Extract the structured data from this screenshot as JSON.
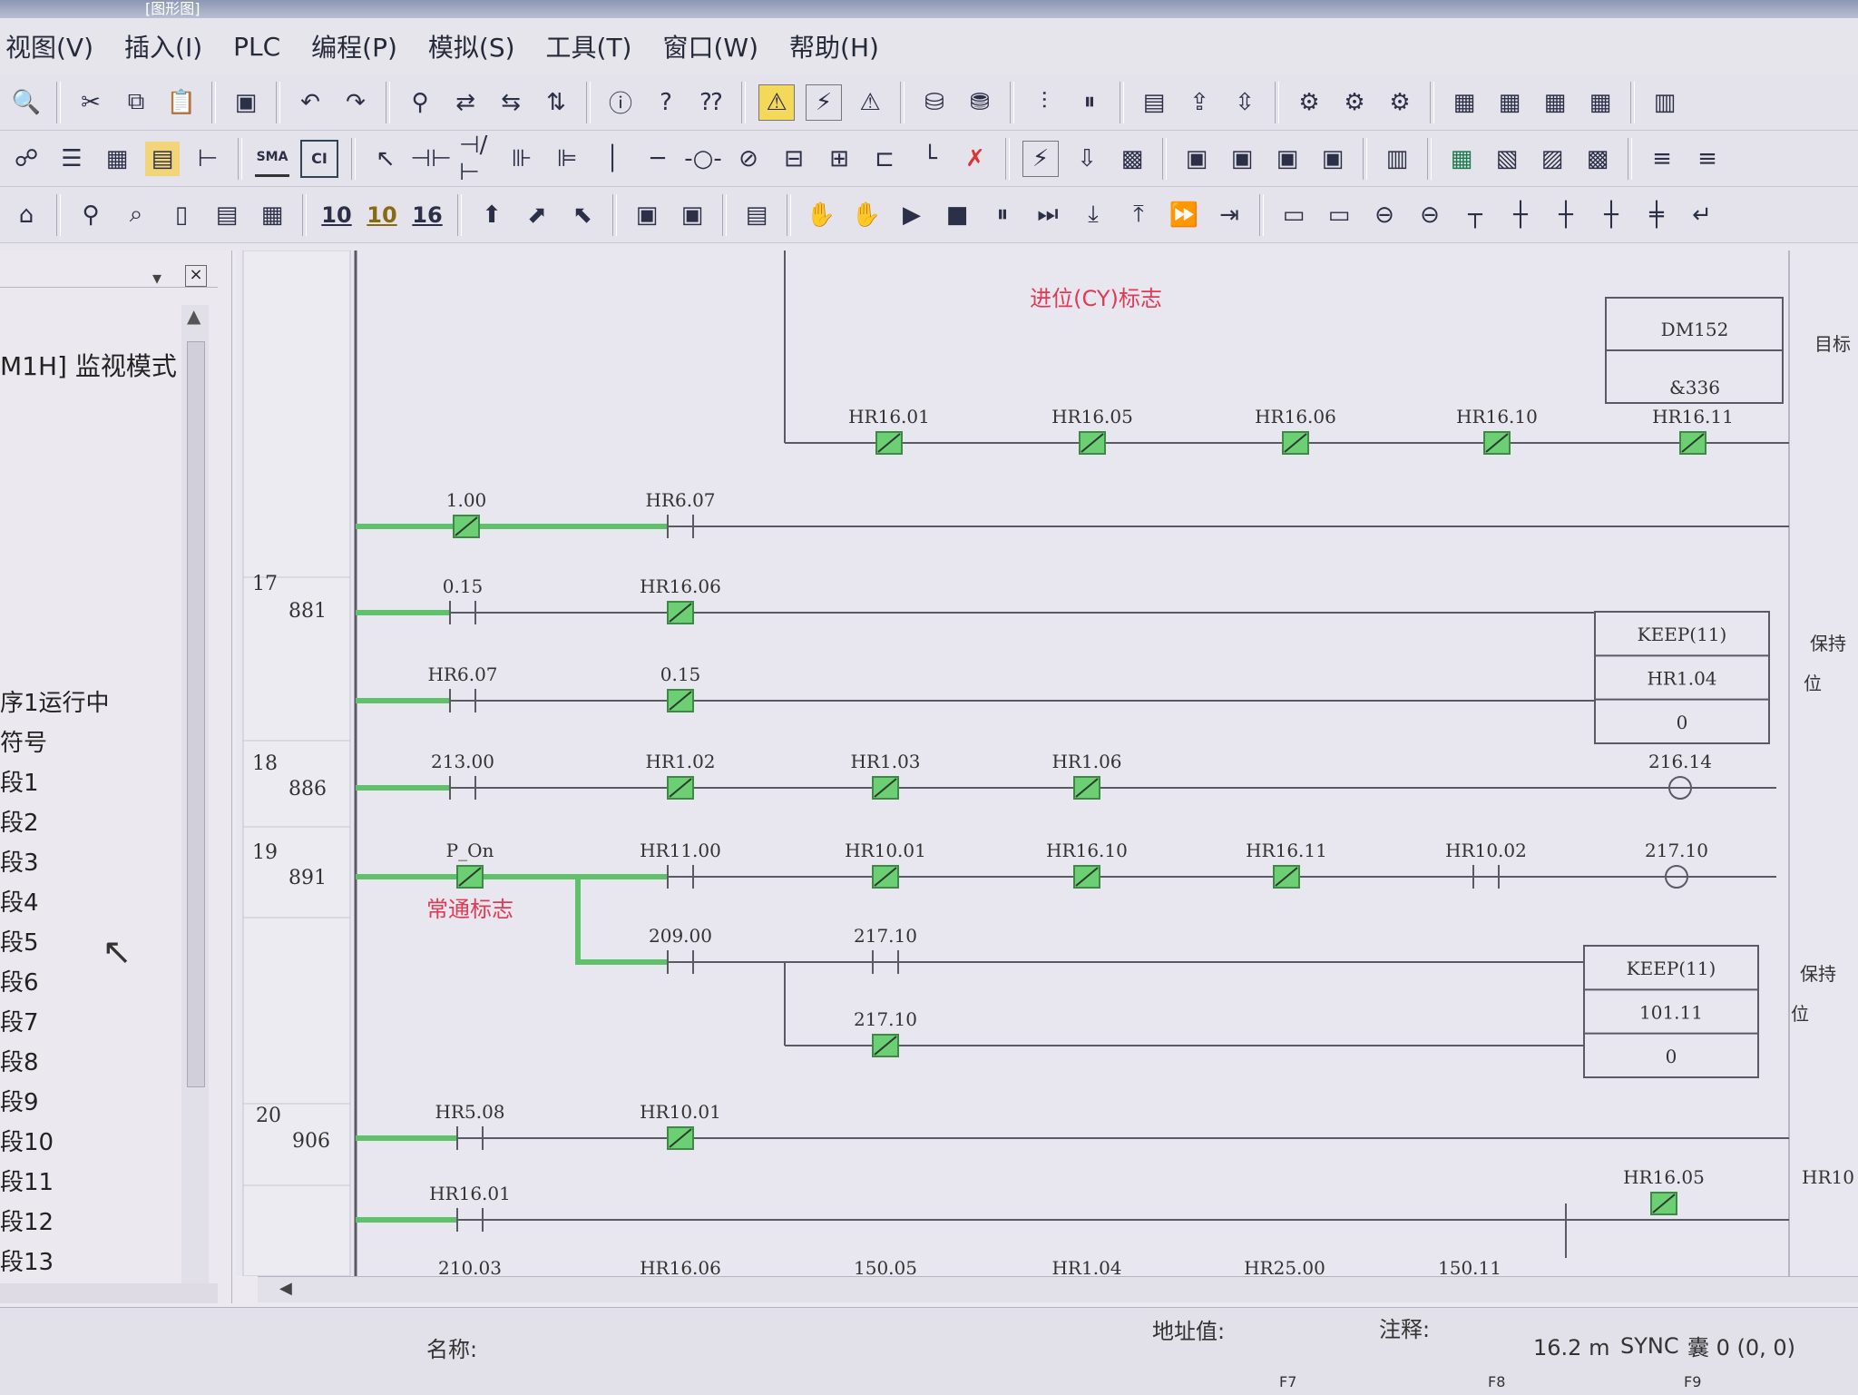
{
  "window": {
    "title": "[图形图]"
  },
  "menu": [
    {
      "id": "view",
      "label": "视图(V)"
    },
    {
      "id": "insert",
      "label": "插入(I)"
    },
    {
      "id": "plc",
      "label": "PLC"
    },
    {
      "id": "program",
      "label": "编程(P)"
    },
    {
      "id": "simulate",
      "label": "模拟(S)"
    },
    {
      "id": "tools",
      "label": "工具(T)"
    },
    {
      "id": "window",
      "label": "窗口(W)"
    },
    {
      "id": "help",
      "label": "帮助(H)"
    }
  ],
  "toolbar_labels": {
    "sma": "SMA",
    "ci": "CI",
    "n10a": "10",
    "n10b": "10",
    "n16": "16"
  },
  "project_panel": {
    "mode_text": "M1H] 监视模式",
    "items": [
      "序1运行中",
      "符号",
      "段1",
      "段2",
      "段3",
      "段4",
      "段5",
      "段6",
      "段7",
      "段8",
      "段9",
      "段10",
      "段11",
      "段12",
      "段13"
    ]
  },
  "ladder": {
    "annotations": {
      "carry_flag": "进位(CY)标志",
      "always_on": "常通标志",
      "target": "目标",
      "keep_a": "保持",
      "keep_b": "位",
      "keep_c": "保持",
      "keep_d": "位"
    },
    "top_block": {
      "line1": "DM152",
      "line2": "&336"
    },
    "top_contacts": [
      "HR16.01",
      "HR16.05",
      "HR16.06",
      "HR16.10",
      "HR16.11"
    ],
    "rungs": [
      {
        "id": "pre",
        "number": "",
        "address": "",
        "contacts": [
          "1.00",
          "HR6.07"
        ]
      },
      {
        "id": "r17",
        "number": "17",
        "address": "881",
        "contacts": [
          "0.15",
          "HR16.06",
          "HR6.07",
          "0.15"
        ],
        "keep": {
          "title": "KEEP(11)",
          "operand": "HR1.04",
          "value": "0"
        }
      },
      {
        "id": "r18",
        "number": "18",
        "address": "886",
        "contacts": [
          "213.00",
          "HR1.02",
          "HR1.03",
          "HR1.06"
        ],
        "coil": "216.14"
      },
      {
        "id": "r19",
        "number": "19",
        "address": "891",
        "contacts": [
          "P_On",
          "HR11.00",
          "HR10.01",
          "HR16.10",
          "HR16.11",
          "HR10.02",
          "209.00",
          "217.10",
          "217.10"
        ],
        "coil": "217.10",
        "keep": {
          "title": "KEEP(11)",
          "operand": "101.11",
          "value": "0"
        }
      },
      {
        "id": "r20",
        "number": "20",
        "address": "906",
        "contacts": [
          "HR5.08",
          "HR10.01",
          "HR16.01",
          "HR16.05",
          "HR10"
        ]
      }
    ],
    "partial_row": [
      "210.03",
      "HR16.06",
      "150.05",
      "HR1.04",
      "HR25.00",
      "150.11"
    ]
  },
  "status": {
    "name_label": "名称:",
    "address_label": "地址值:",
    "comment_label": "注释:",
    "time": "16.2 m",
    "sync": "SYNC",
    "pos": "囊 0 (0, 0)",
    "f7": "F7",
    "f8": "F8",
    "f9": "F9"
  },
  "colors": {
    "energized": "#5fc26a",
    "nc_fill": "#6ccf74",
    "rail": "#5a5a66",
    "wire": "#5a5a66",
    "red": "#e03a55"
  }
}
